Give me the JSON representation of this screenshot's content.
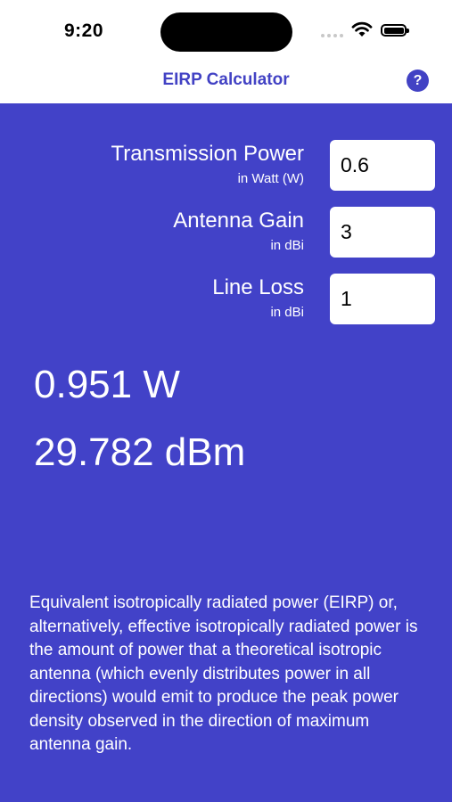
{
  "status_bar": {
    "time": "9:20"
  },
  "nav": {
    "title": "EIRP Calculator",
    "help_label": "?"
  },
  "fields": [
    {
      "label": "Transmission Power",
      "unit": "in Watt (W)",
      "value": "0.6"
    },
    {
      "label": "Antenna Gain",
      "unit": "in dBi",
      "value": "3"
    },
    {
      "label": "Line Loss",
      "unit": "in dBi",
      "value": "1"
    }
  ],
  "results": {
    "watts": "0.951 W",
    "dbm": "29.782 dBm"
  },
  "description": "Equivalent isotropically radiated power (EIRP) or, alternatively, effective isotropically radiated power is the amount of power that a theoretical isotropic antenna (which evenly distributes power in all directions) would emit to produce the peak power density observed in the direction of maximum antenna gain.",
  "colors": {
    "accent": "#4242c4",
    "background": "#4242c8",
    "text": "#ffffff"
  }
}
